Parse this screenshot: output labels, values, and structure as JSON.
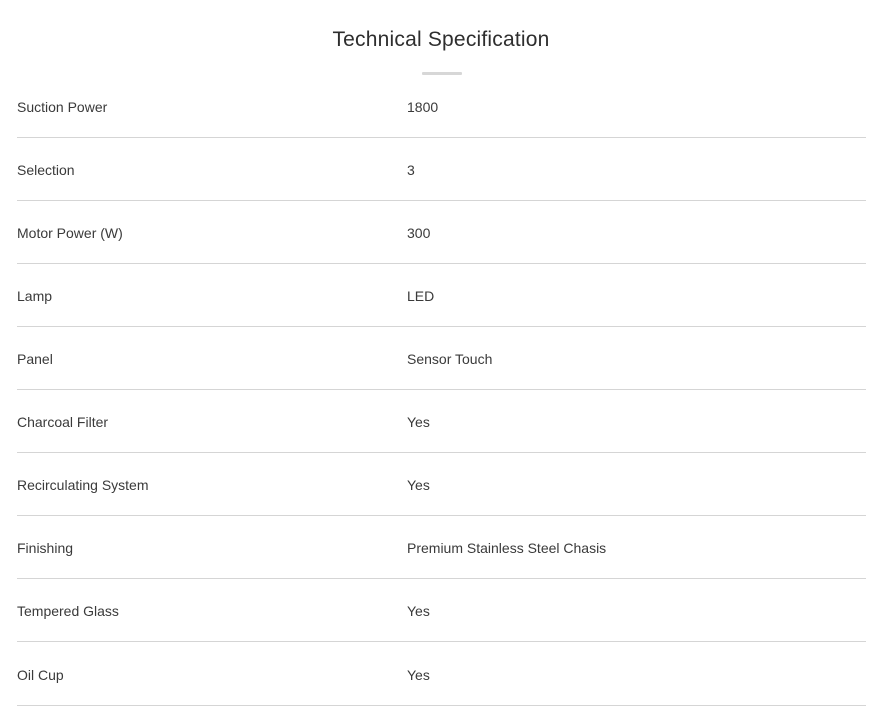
{
  "header": {
    "title": "Technical Specification"
  },
  "specs": [
    {
      "label": "Suction Power",
      "value": "1800"
    },
    {
      "label": "Selection",
      "value": "3"
    },
    {
      "label": "Motor Power (W)",
      "value": "300"
    },
    {
      "label": "Lamp",
      "value": "LED"
    },
    {
      "label": "Panel",
      "value": "Sensor Touch"
    },
    {
      "label": "Charcoal Filter",
      "value": "Yes"
    },
    {
      "label": "Recirculating System",
      "value": "Yes"
    },
    {
      "label": "Finishing",
      "value": "Premium Stainless Steel Chasis"
    },
    {
      "label": "Tempered Glass",
      "value": "Yes"
    },
    {
      "label": "Oil Cup",
      "value": "Yes"
    }
  ],
  "colors": {
    "text": "#3a3a3a",
    "divider": "#d5d5d5",
    "underline": "#d7d7d7",
    "background": "#ffffff"
  }
}
